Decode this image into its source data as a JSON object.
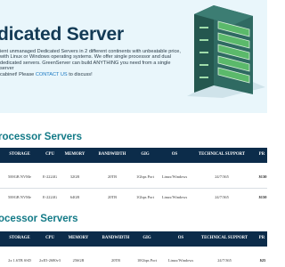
{
  "hero": {
    "title": "dicated Server",
    "desc_lines": [
      "ient unmanaged Dedicated Servers in 2 different continents with unbeatable price,",
      "with Linux or Windows operating systems. We offer single processor and dual",
      "dedicated servers. GreenServer can build ANYTHING you need from a single server",
      "cabinet! Please "
    ],
    "contact_link": "CONTACT US",
    "desc_end": " to discuss!"
  },
  "section1": {
    "title": "rocessor Servers",
    "headers": [
      "STORAGE",
      "CPU",
      "MEMORY",
      "BANDWIDTH",
      "GIG",
      "OS",
      "TECHNICAL SUPPORT",
      "PR"
    ],
    "rows": [
      [
        "500GB NVMe",
        "E-2224G",
        "32GB",
        "20TB",
        "1Gbps Port",
        "Linux/Windows",
        "24/7/365",
        "$130"
      ],
      [
        "500GB NVMe",
        "E-2224G",
        "64GB",
        "20TB",
        "1Gbps Port",
        "Linux/Windows",
        "24/7/365",
        "$150"
      ]
    ]
  },
  "section2": {
    "title": "ocessor Servers",
    "headers": [
      "STORAGE",
      "CPU",
      "MEMORY",
      "BANDWIDTH",
      "GIG",
      "OS",
      "TECHNICAL SUPPORT",
      "PR"
    ],
    "rows": [
      [
        "2x 1.6TB SSD",
        "2xE5-2680v3",
        "256GB",
        "20TB",
        "10Gbps Port",
        "Linux/Windows",
        "24/7/365",
        "$25"
      ]
    ]
  },
  "colors": {
    "hero_bg": "#e9f6fb",
    "title": "#133a55",
    "section_title": "#137a87",
    "table_header": "#0c2c4a",
    "link": "#1a78c2",
    "server_green": "#5bb96b"
  }
}
